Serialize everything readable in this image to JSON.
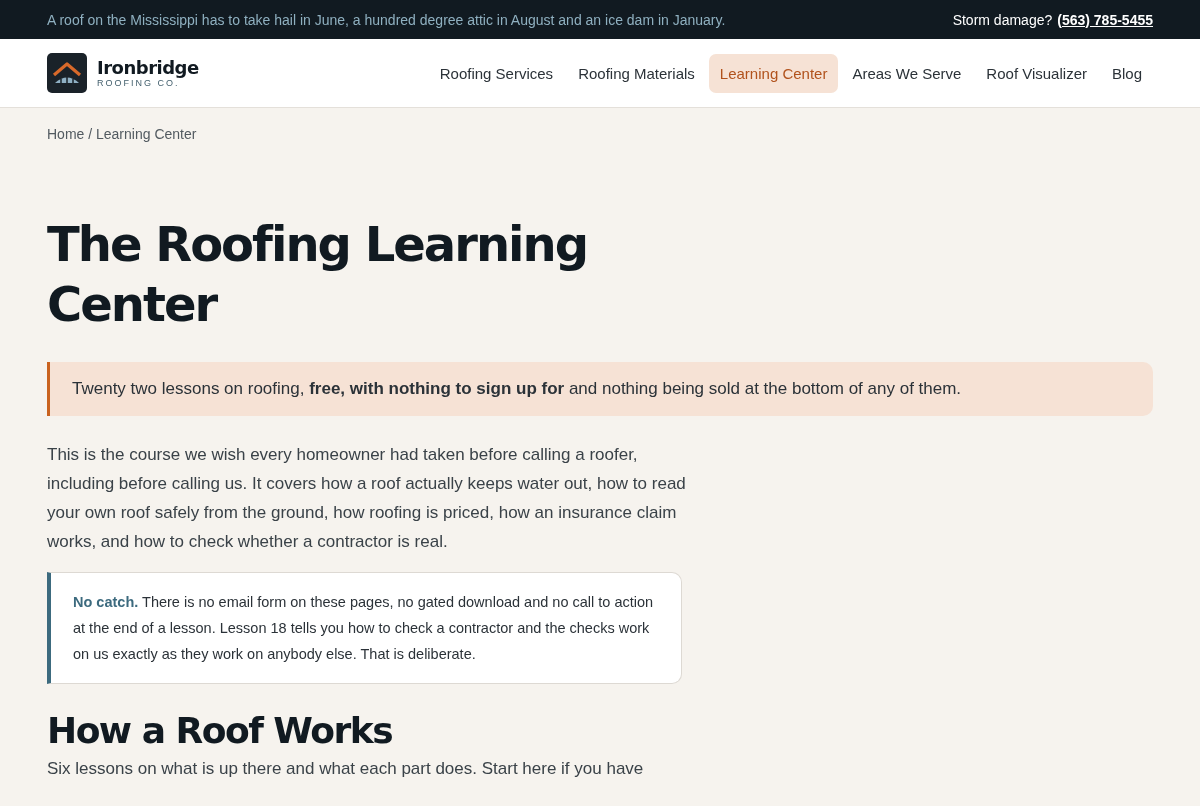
{
  "top_bar": {
    "message": "A roof on the Mississippi has to take hail in June, a hundred degree attic in August and an ice dam in January.",
    "storm_label": "Storm damage?",
    "phone": "(563) 785-5455"
  },
  "brand": {
    "name": "Ironbridge",
    "tagline": "ROOFING CO."
  },
  "nav": [
    {
      "label": "Roofing Services",
      "selected": false
    },
    {
      "label": "Roofing Materials",
      "selected": false
    },
    {
      "label": "Learning Center",
      "selected": true
    },
    {
      "label": "Areas We Serve",
      "selected": false
    },
    {
      "label": "Roof Visualizer",
      "selected": false
    },
    {
      "label": "Blog",
      "selected": false
    }
  ],
  "breadcrumb": "Home / Learning Center",
  "title": "The Roofing Learning Center",
  "callout": "Twenty two lessons on roofing, **free, with nothing to sign up for** and nothing being sold at the bottom of any of them.",
  "intro": "This is the course we wish every homeowner had taken before calling a roofer, including before calling us. It covers how a roof actually keeps water out, how to read your own roof safely from the ground, how roofing is priced, how an insurance claim works, and how to check whether a contractor is real.",
  "note": {
    "text": "**No catch.** There is no email form on these pages, no gated download and no call to action at the end of a lesson. Lesson 18 tells you how to check a contractor and the checks work on us exactly as they work on anybody else. That is deliberate."
  },
  "section": {
    "title": "How a Roof Works",
    "lead": "Six lessons on what is up there and what each part does. Start here if you have"
  }
}
